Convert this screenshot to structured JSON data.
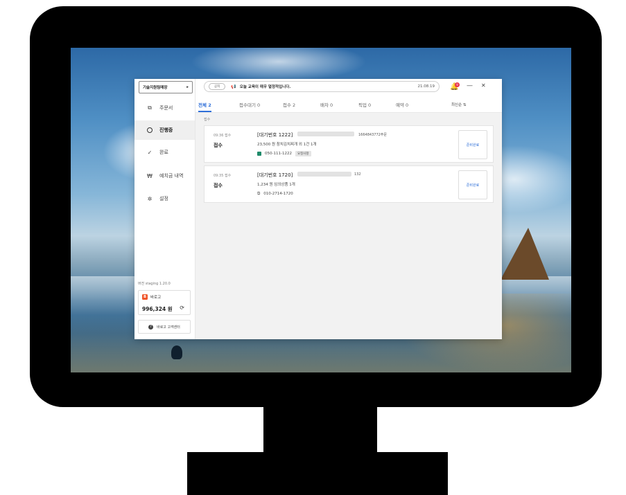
{
  "sidebar": {
    "store_name": "기술지원팀매장",
    "store_caret": "▸",
    "items": [
      {
        "label": "주문서",
        "icon": "copy-icon",
        "glyph": "⧉"
      },
      {
        "label": "진행중",
        "icon": "ring-icon",
        "glyph": ""
      },
      {
        "label": "완료",
        "icon": "check-icon",
        "glyph": "✓"
      },
      {
        "label": "예치금 내역",
        "icon": "won-icon",
        "glyph": "₩"
      },
      {
        "label": "설정",
        "icon": "gear-icon",
        "glyph": "✲"
      }
    ],
    "active_index": 1,
    "version": "버전 staging 1.20.0",
    "brand_name": "바로고",
    "brand_logo_glyph": "B",
    "balance": "996,324 원",
    "refresh_glyph": "⟳",
    "cs_label": "바로고 고객센터",
    "cs_icon_glyph": "?"
  },
  "topbar": {
    "notice_pill": "공지",
    "notice_text": "오늘 교육이 매우 열정적입니다.",
    "notice_date": "21.08.19",
    "megaphone_glyph": "📢",
    "bell_glyph": "🔔",
    "bell_badge": "9",
    "minimize_glyph": "—",
    "close_glyph": "✕"
  },
  "tabs": [
    {
      "label": "전체 2"
    },
    {
      "label": "접수대기 0"
    },
    {
      "label": "접수 2"
    },
    {
      "label": "배차 0"
    },
    {
      "label": "픽업 0"
    },
    {
      "label": "예약 0"
    }
  ],
  "sort_label": "최신순 ⇅",
  "section_label": "접수",
  "orders": [
    {
      "time": "09:36 접수",
      "status": "접수",
      "number": "[대기번호 1222]",
      "extra": "1664843772주문",
      "price_line": "23,500 원   참치김치찌개 외 1건 1개",
      "phone": "050-111-1222",
      "tag": "요청사항",
      "button": "준비완료"
    },
    {
      "time": "09:35 접수",
      "status": "접수",
      "number": "[대기번호 1720]",
      "extra": "132",
      "price_line": "1,234 원   임의상품 1개",
      "phone": "010-2714-1720",
      "tag": "",
      "button": "준비완료"
    }
  ]
}
